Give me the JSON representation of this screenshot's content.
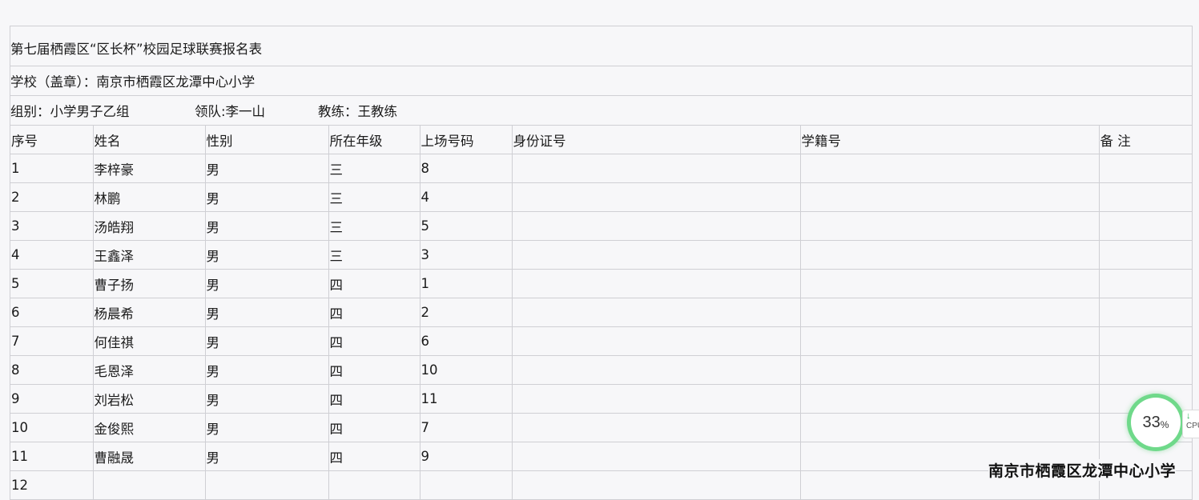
{
  "form": {
    "title": "第七届栖霞区“区长杯”校园足球联赛报名表",
    "school_line": "学校（盖章）：南京市栖霞区龙潭中心小学",
    "group_line": "组别：小学男子乙组",
    "leader_line": "领队:李一山",
    "coach_line": "教练：王教练"
  },
  "table": {
    "headers": [
      "序号",
      "姓名",
      "性别",
      "所在年级",
      "上场号码",
      "身份证号",
      "学籍号",
      "备  注"
    ],
    "rows": [
      [
        "1",
        "李梓豪",
        "男",
        "三",
        "8",
        "",
        "",
        ""
      ],
      [
        "2",
        "林鹏",
        "男",
        "三",
        "4",
        "",
        "",
        ""
      ],
      [
        "3",
        "汤皓翔",
        "男",
        "三",
        "5",
        "",
        "",
        ""
      ],
      [
        "4",
        "王鑫泽",
        "男",
        "三",
        "3",
        "",
        "",
        ""
      ],
      [
        "5",
        "曹子扬",
        "男",
        "四",
        "1",
        "",
        "",
        ""
      ],
      [
        "6",
        "杨晨希",
        "男",
        "四",
        "2",
        "",
        "",
        ""
      ],
      [
        "7",
        "何佳祺",
        "男",
        "四",
        "6",
        "",
        "",
        ""
      ],
      [
        "8",
        "毛恩泽",
        "男",
        "四",
        "10",
        "",
        "",
        ""
      ],
      [
        "9",
        "刘岩松",
        "男",
        "四",
        "11",
        "",
        "",
        ""
      ],
      [
        "10",
        "金俊熙",
        "男",
        "四",
        "7",
        "",
        "",
        ""
      ],
      [
        "11",
        "曹融晟",
        "男",
        "四",
        "9",
        "",
        "",
        ""
      ],
      [
        "12",
        "",
        "",
        "",
        "",
        "",
        "",
        ""
      ]
    ]
  },
  "overlay": {
    "cpu_value": "33",
    "cpu_unit": "%",
    "cpu_label": "CPU",
    "arrow_icon": "download-arrow-icon",
    "watermark": "南京市栖霞区龙潭中心小学"
  }
}
